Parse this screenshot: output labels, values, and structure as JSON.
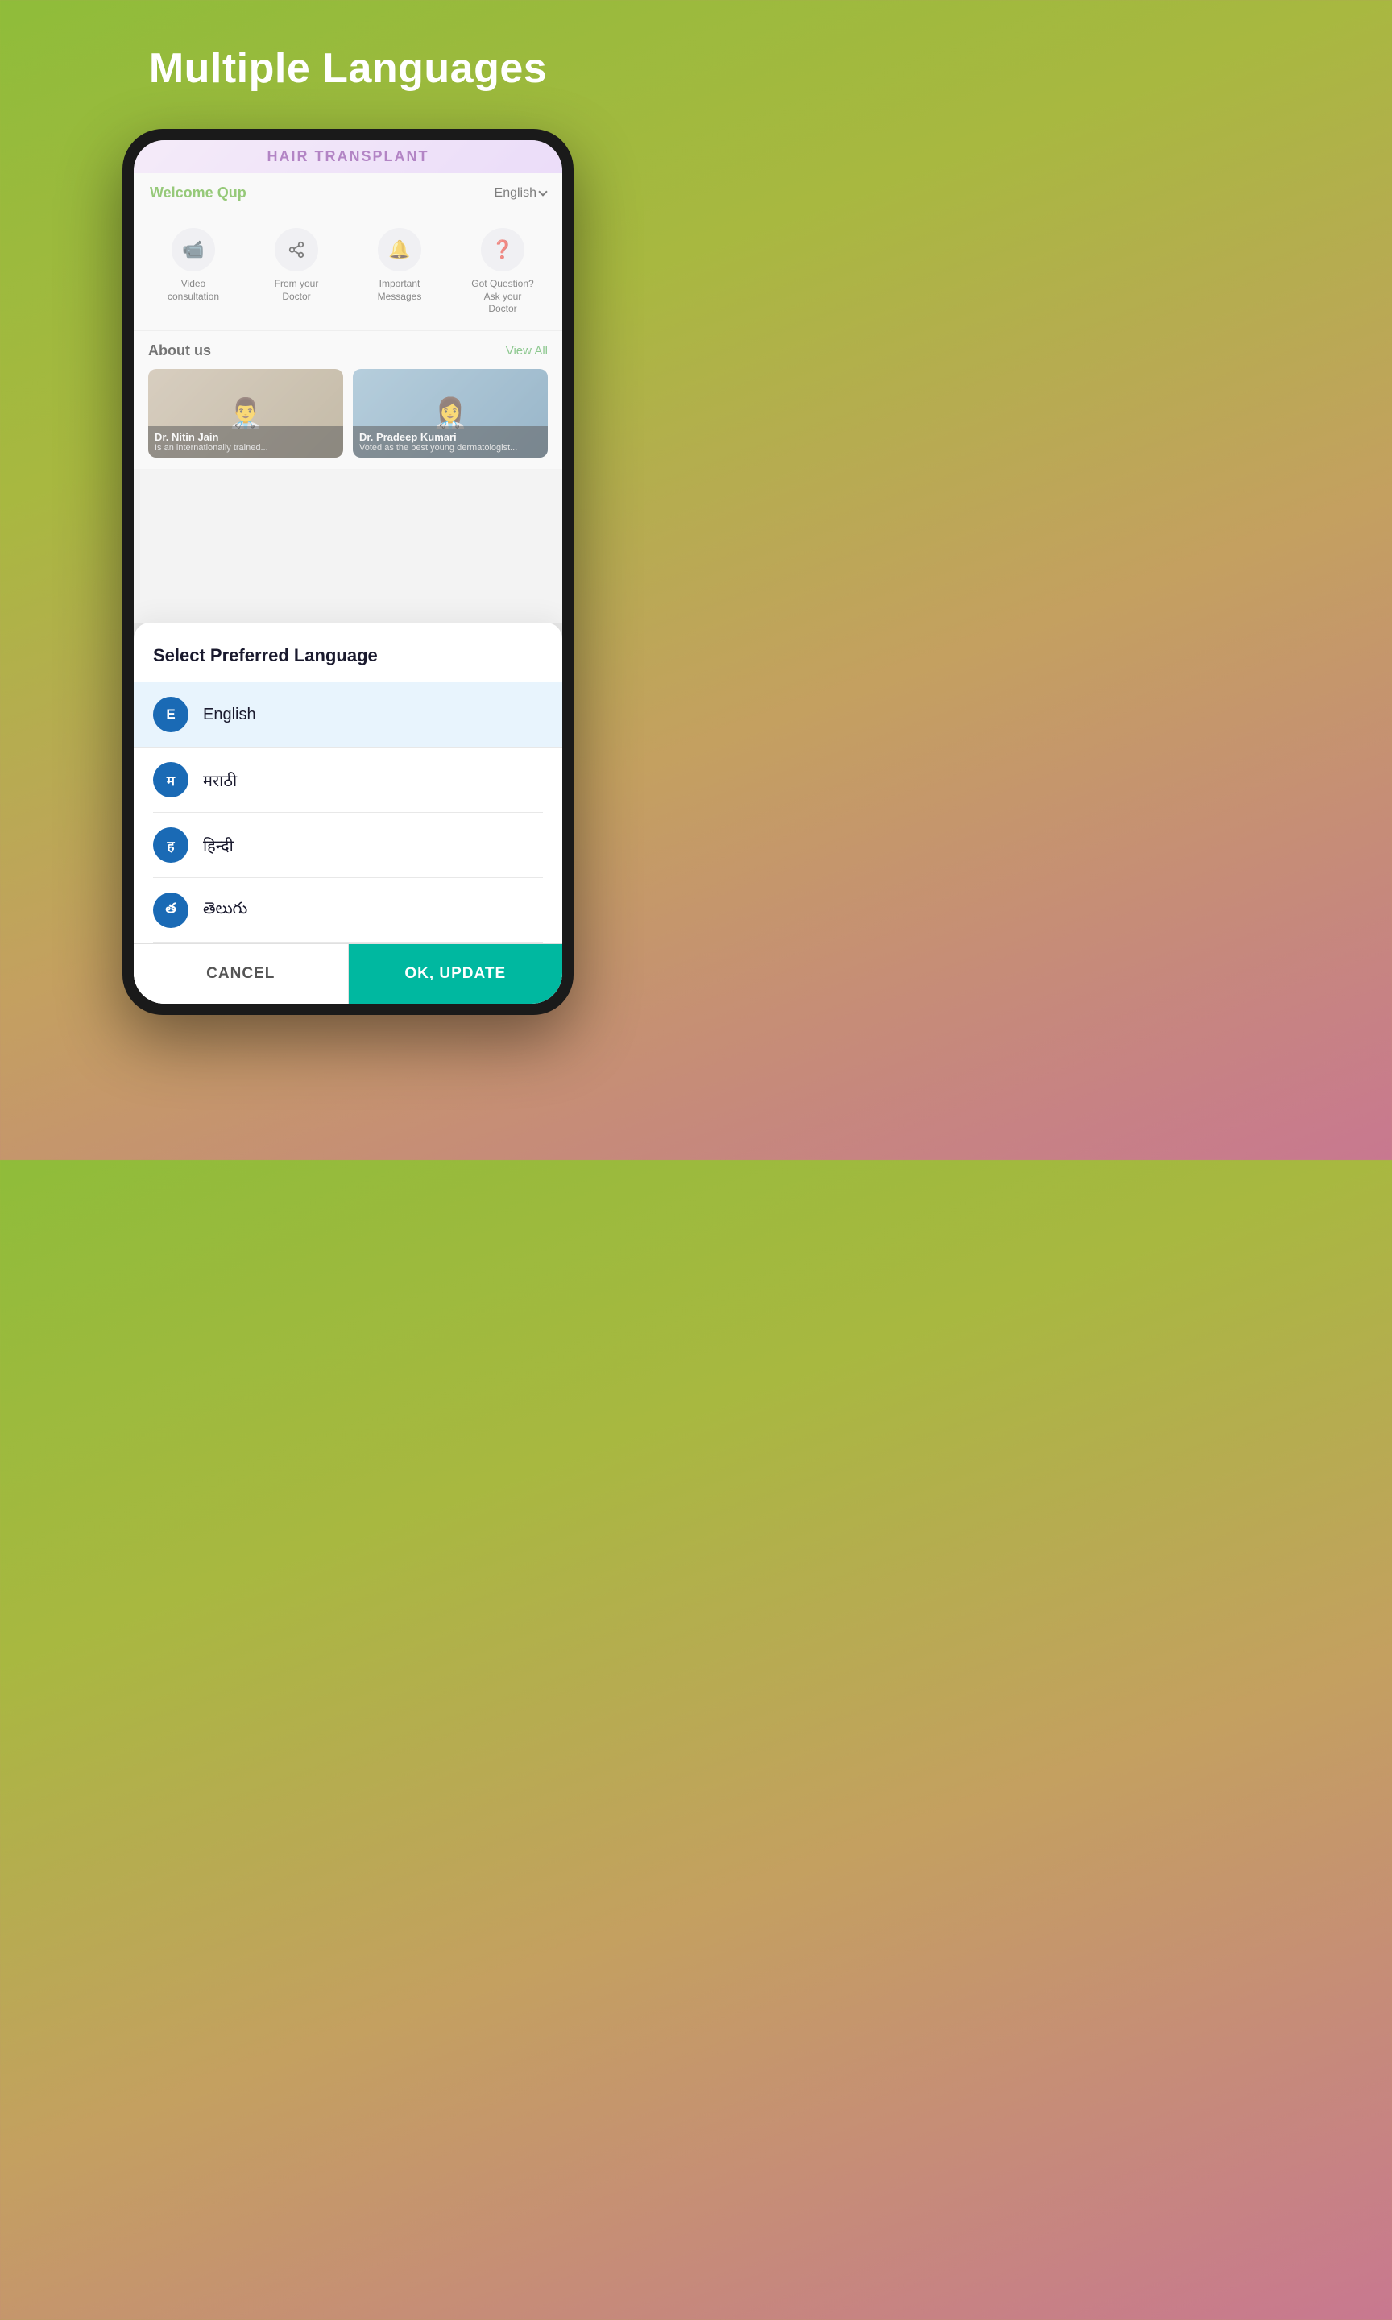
{
  "page": {
    "title": "Multiple Languages",
    "background_gradient": "linear-gradient(160deg, #8fbc3a 0%, #a8b840 30%, #c4a060 60%, #c87890 100%)"
  },
  "app": {
    "header": {
      "welcome": "Welcome Qup",
      "language": "English"
    },
    "banner": "HAIR TRANSPLANT",
    "quick_actions": [
      {
        "icon": "🎥",
        "label": "Video consultation"
      },
      {
        "icon": "⎆",
        "label": "From your Doctor"
      },
      {
        "icon": "🔔",
        "label": "Important Messages"
      },
      {
        "icon": "❓",
        "label": "Got Question? Ask your Doctor"
      }
    ],
    "about_us": {
      "title": "About us",
      "view_all": "View All",
      "doctors": [
        {
          "name": "Dr. Nitin Jain",
          "desc": "Is an internationally trained..."
        },
        {
          "name": "Dr. Pradeep Kumari",
          "desc": "Voted as the best young dermatologist..."
        }
      ]
    }
  },
  "language_modal": {
    "title": "Select Preferred Language",
    "languages": [
      {
        "avatar": "E",
        "name": "English",
        "selected": true
      },
      {
        "avatar": "म",
        "name": "मराठी",
        "selected": false
      },
      {
        "avatar": "ह",
        "name": "हिन्दी",
        "selected": false
      },
      {
        "avatar": "త",
        "name": "తెలుగు",
        "selected": false
      }
    ],
    "cancel_label": "CANCEL",
    "ok_label": "OK, UPDATE"
  }
}
